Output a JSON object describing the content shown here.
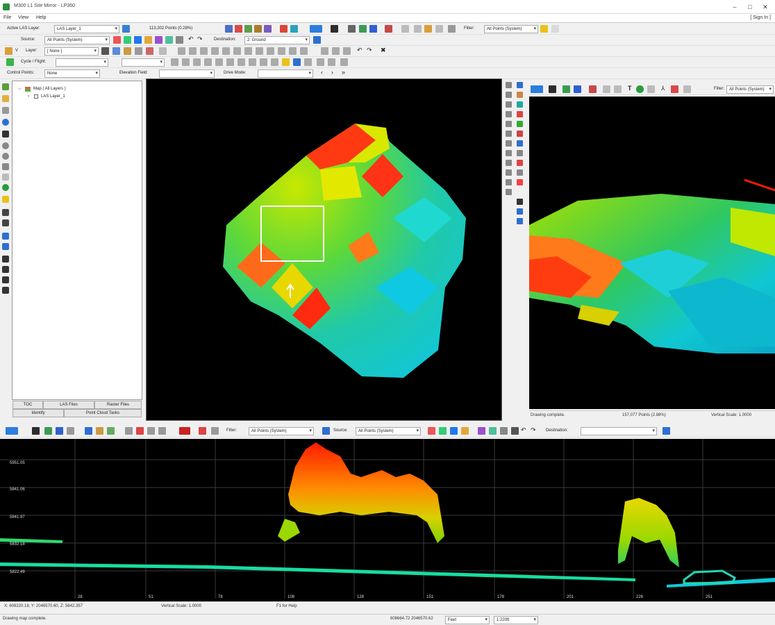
{
  "window": {
    "title": "M300 L1 Site Mirror - LP360",
    "minimize": "–",
    "maximize": "□",
    "close": "✕"
  },
  "menu": {
    "items": [
      "File",
      "View",
      "Help"
    ],
    "sign_in": "[ Sign In ]"
  },
  "toolbar1": {
    "active_las_label": "Active LAS Layer:",
    "active_las_value": "LAS Layer_1",
    "points_count": "113,302 Points (0.28%)",
    "filter_label": "Filter:",
    "filter_value": "All Points (System)"
  },
  "toolbar2": {
    "source_label": "Source:",
    "source_value": "All Points (System)",
    "destination_label": "Destination:",
    "destination_value": "2: Ground"
  },
  "toolbar3": {
    "layer_label": "Layer:",
    "layer_value": "[ None ]"
  },
  "toolbar4": {
    "cycle_label": "Cycle / Flight:"
  },
  "toolbar5": {
    "control_points_label": "Control Points:",
    "control_points_value": "None",
    "elevation_field_label": "Elevation Field:",
    "drive_mode_label": "Drive Mode:"
  },
  "tree": {
    "root": "Map ( All Layers )",
    "child": "LAS Layer_1"
  },
  "left_tabs": {
    "row1": [
      "TOC",
      "LAS Files",
      "Raster Files"
    ],
    "row2": [
      "Identify",
      "Point Cloud Tasks"
    ]
  },
  "view3d": {
    "filter_label": "Filter:",
    "filter_value": "All Points (System)",
    "status_left": "Drawing complete.",
    "status_mid": "157,077 Points (2.88%)",
    "status_right": "Vertical Scale: 1.0000"
  },
  "profile_toolbar": {
    "filter_label": "Filter:",
    "filter_value": "All Points (System)",
    "source_label": "Source:",
    "source_value": "All Points (System)",
    "destination_label": "Destination:",
    "destination_value": ""
  },
  "profile": {
    "y_labels": [
      "5951.05",
      "5841.06",
      "5841.97",
      "5832.18",
      "5822.49"
    ],
    "x_labels": [
      "28",
      "51",
      "78",
      "108",
      "128",
      "151",
      "178",
      "201",
      "226",
      "251"
    ]
  },
  "profile_status": {
    "coords": "X: 608220.18, Y: 2046570.60, Z: 5842.357",
    "vscale": "Vertical Scale: 1.0000",
    "help": "F1 for Help"
  },
  "app_status": {
    "message": "Drawing map complete.",
    "coords": "608664.72 2046570.62",
    "units": "Feet",
    "scale": "1:220ft"
  },
  "colors": {
    "elev_low": "#00e5ff",
    "elev_mid": "#9bff00",
    "elev_high": "#ff1a00"
  }
}
